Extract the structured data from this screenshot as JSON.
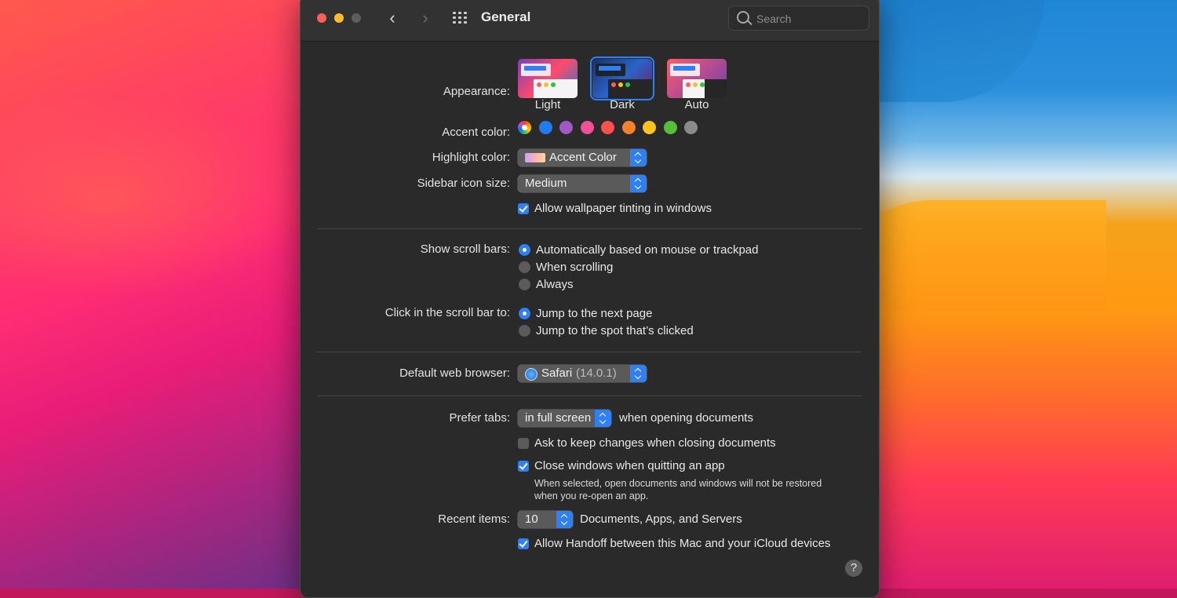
{
  "window": {
    "title": "General",
    "search_placeholder": "Search"
  },
  "appearance": {
    "label": "Appearance:",
    "options": [
      {
        "name": "Light",
        "selected": false
      },
      {
        "name": "Dark",
        "selected": true
      },
      {
        "name": "Auto",
        "selected": false
      }
    ]
  },
  "accent": {
    "label": "Accent color:",
    "colors": [
      "multicolor",
      "#1f7cf0",
      "#a259c4",
      "#f0509a",
      "#ff4f4f",
      "#f5822a",
      "#fcc31e",
      "#56bf3a",
      "#8b8b8c"
    ],
    "selected_index": 0
  },
  "highlight": {
    "label": "Highlight color:",
    "value": "Accent Color"
  },
  "sidebar_icon": {
    "label": "Sidebar icon size:",
    "value": "Medium"
  },
  "wallpaper_tinting": {
    "label": "Allow wallpaper tinting in windows",
    "checked": true
  },
  "scroll_bars": {
    "label": "Show scroll bars:",
    "options": [
      "Automatically based on mouse or trackpad",
      "When scrolling",
      "Always"
    ],
    "selected_index": 0
  },
  "click_scroll": {
    "label": "Click in the scroll bar to:",
    "options": [
      "Jump to the next page",
      "Jump to the spot that’s clicked"
    ],
    "selected_index": 0
  },
  "browser": {
    "label": "Default web browser:",
    "name": "Safari",
    "version": "(14.0.1)"
  },
  "tabs": {
    "label": "Prefer tabs:",
    "value": "in full screen",
    "suffix": "when opening documents"
  },
  "ask_keep": {
    "label": "Ask to keep changes when closing documents",
    "checked": false
  },
  "close_windows": {
    "label": "Close windows when quitting an app",
    "checked": true,
    "note_line1": "When selected, open documents and windows will not be restored",
    "note_line2": "when you re-open an app."
  },
  "recent": {
    "label": "Recent items:",
    "value": "10",
    "suffix": "Documents, Apps, and Servers"
  },
  "handoff": {
    "label": "Allow Handoff between this Mac and your iCloud devices",
    "checked": true
  },
  "help": "?"
}
